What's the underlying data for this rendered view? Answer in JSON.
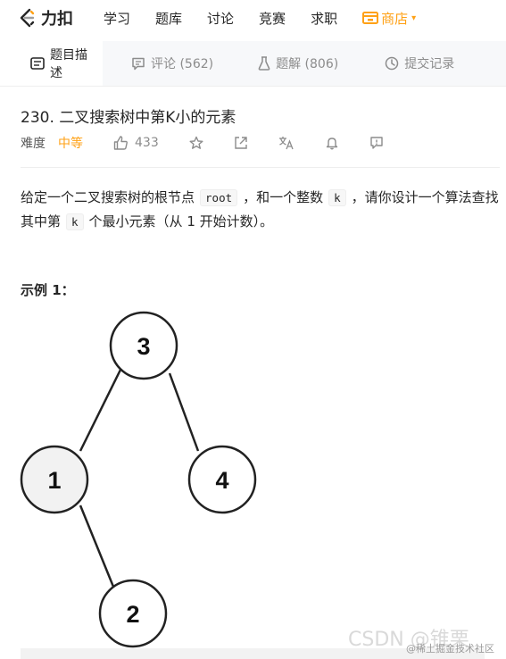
{
  "nav": {
    "logo_text": "力扣",
    "items": [
      "学习",
      "题库",
      "讨论",
      "竞赛",
      "求职"
    ],
    "store": "商店"
  },
  "tabs": [
    {
      "label": "题目描述"
    },
    {
      "label": "评论 (562)"
    },
    {
      "label": "题解 (806)"
    },
    {
      "label": "提交记录"
    }
  ],
  "problem": {
    "title": "230. 二叉搜索树中第K小的元素",
    "difficulty_label": "难度",
    "difficulty": "中等",
    "likes": "433"
  },
  "description": {
    "part1": "给定一个二叉搜索树的根节点",
    "code1": "root",
    "part2": "，和一个整数",
    "code2": "k",
    "part3": "，请你设计一个算法查找其中第",
    "code3": "k",
    "part4": "个最小元素（从 1 开始计数）。"
  },
  "example": {
    "heading": "示例 1：",
    "nodes": [
      {
        "label": "3",
        "highlight": false
      },
      {
        "label": "1",
        "highlight": true
      },
      {
        "label": "4",
        "highlight": false
      },
      {
        "label": "2",
        "highlight": false
      }
    ]
  },
  "watermark": {
    "csdn": "CSDN @锥栗",
    "juejin": "@稀土掘金技术社区"
  },
  "colors": {
    "accent": "#ffa116",
    "highlight_node": "#f2f2f2"
  }
}
